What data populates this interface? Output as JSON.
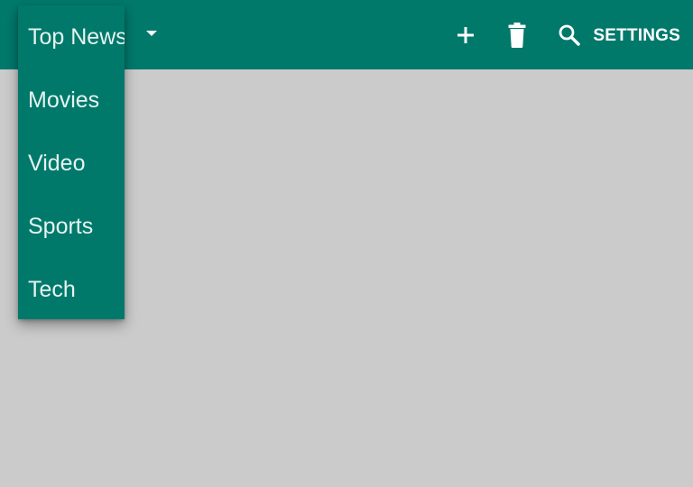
{
  "theme": {
    "primary": "#00796b",
    "background": "#cbcbcb",
    "on_primary": "#ffffff"
  },
  "toolbar": {
    "actions": [
      {
        "name": "add",
        "icon": "plus-icon"
      },
      {
        "name": "delete",
        "icon": "trash-icon"
      },
      {
        "name": "search",
        "icon": "search-icon"
      }
    ],
    "settings_label": "SETTINGS",
    "dropdown_icon": "caret-down-icon"
  },
  "menu": {
    "selected": "Top News",
    "items": [
      {
        "label": "Top News"
      },
      {
        "label": "Movies"
      },
      {
        "label": "Video"
      },
      {
        "label": "Sports"
      },
      {
        "label": "Tech"
      }
    ]
  }
}
